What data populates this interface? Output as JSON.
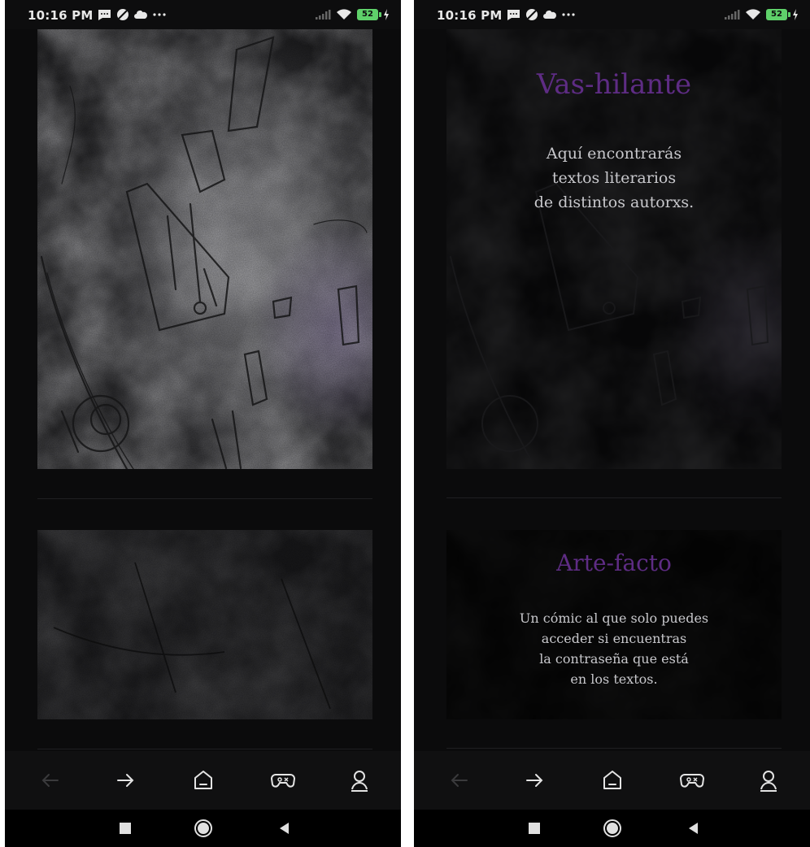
{
  "screens": [
    {
      "status_bar": {
        "time": "10:16 PM",
        "left_icons": [
          "message-icon",
          "dnd-icon",
          "cloud-icon",
          "more-dots-icon"
        ],
        "right_icons": [
          "signal-icon",
          "wifi-icon",
          "battery-icon",
          "charging-icon"
        ],
        "battery_level": "52"
      },
      "cards": [
        {
          "title": "",
          "description": ""
        },
        {
          "title": "",
          "description": ""
        }
      ],
      "toolbar": {
        "icons": [
          "back-arrow-icon",
          "forward-arrow-icon",
          "home-icon",
          "game-icon",
          "profile-icon"
        ],
        "back_disabled": true
      },
      "nav": {
        "icons": [
          "recents-square-icon",
          "home-circle-icon",
          "back-triangle-icon"
        ]
      }
    },
    {
      "status_bar": {
        "time": "10:16 PM",
        "left_icons": [
          "message-icon",
          "dnd-icon",
          "cloud-icon",
          "more-dots-icon"
        ],
        "right_icons": [
          "signal-icon",
          "wifi-icon",
          "battery-icon",
          "charging-icon"
        ],
        "battery_level": "52"
      },
      "cards": [
        {
          "title": "Vas-hilante",
          "description": "Aquí encontrarás\ntextos literarios\nde distintos autorxs."
        },
        {
          "title": "Arte-facto",
          "description": "Un cómic al que solo puedes\nacceder si encuentras\nla contraseña que está\nen los textos."
        }
      ],
      "toolbar": {
        "icons": [
          "back-arrow-icon",
          "forward-arrow-icon",
          "home-icon",
          "game-icon",
          "profile-icon"
        ],
        "back_disabled": true
      },
      "nav": {
        "icons": [
          "recents-square-icon",
          "home-circle-icon",
          "back-triangle-icon"
        ]
      }
    }
  ],
  "colors": {
    "title_purple": "#5e2c84",
    "background": "#0b0b0c",
    "battery_green": "#5fd16a"
  }
}
